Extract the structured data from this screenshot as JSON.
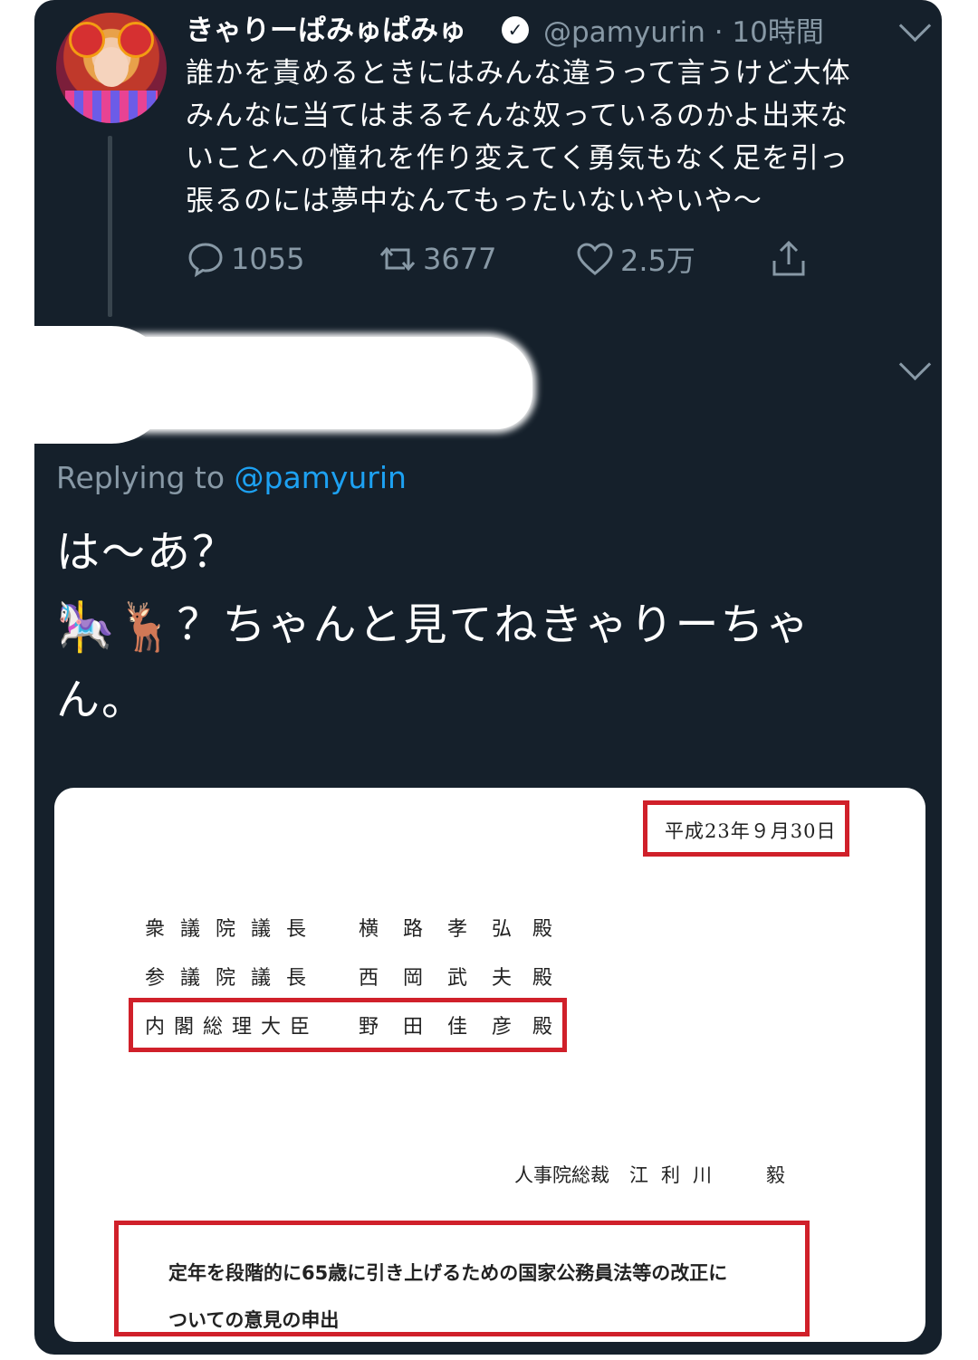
{
  "original_tweet": {
    "display_name": "きゃりーぱみゅぱみゅ",
    "verified_icon": "✓",
    "handle_time": "@pamyurin · 10時間",
    "text_lines": [
      "誰かを責めるときにはみんな違うって言うけど大体",
      "みんなに当てはまるそんな奴っているのかよ出来な",
      "いことへの憧れを作り変えてく勇気もなく足を引っ",
      "張るのには夢中なんてもったいないやいや〜"
    ],
    "actions": {
      "reply_count": "1055",
      "retweet_count": "3677",
      "like_count": "2.5万"
    }
  },
  "reply_tweet": {
    "replying_prefix": "Replying to",
    "replying_handle": "@pamyurin",
    "line1": "は〜あ？",
    "emoji1": "🎠",
    "emoji2": "🦌",
    "line2": "？ちゃんと見てねきゃりーちゃ",
    "line3": "ん。"
  },
  "document": {
    "date": "平成23年９月30日",
    "addressees": [
      {
        "title": "衆議院議長",
        "name": "横路孝弘",
        "suffix": "殿"
      },
      {
        "title": "参議院議長",
        "name": "西岡武夫",
        "suffix": "殿"
      },
      {
        "title": "内閣総理大臣",
        "name": "野田佳彦",
        "suffix": "殿"
      }
    ],
    "sender_title": "人事院総裁",
    "sender_name": "江利川",
    "sender_name2": "毅",
    "subject_line1": "定年を段階的に65歳に引き上げるための国家公務員法等の改正に",
    "subject_line2": "ついての意見の申出"
  },
  "colors": {
    "background": "#15202b",
    "text": "#ffffff",
    "muted": "#8899a6",
    "link": "#1da1f2",
    "highlight_box": "#d0202a"
  }
}
